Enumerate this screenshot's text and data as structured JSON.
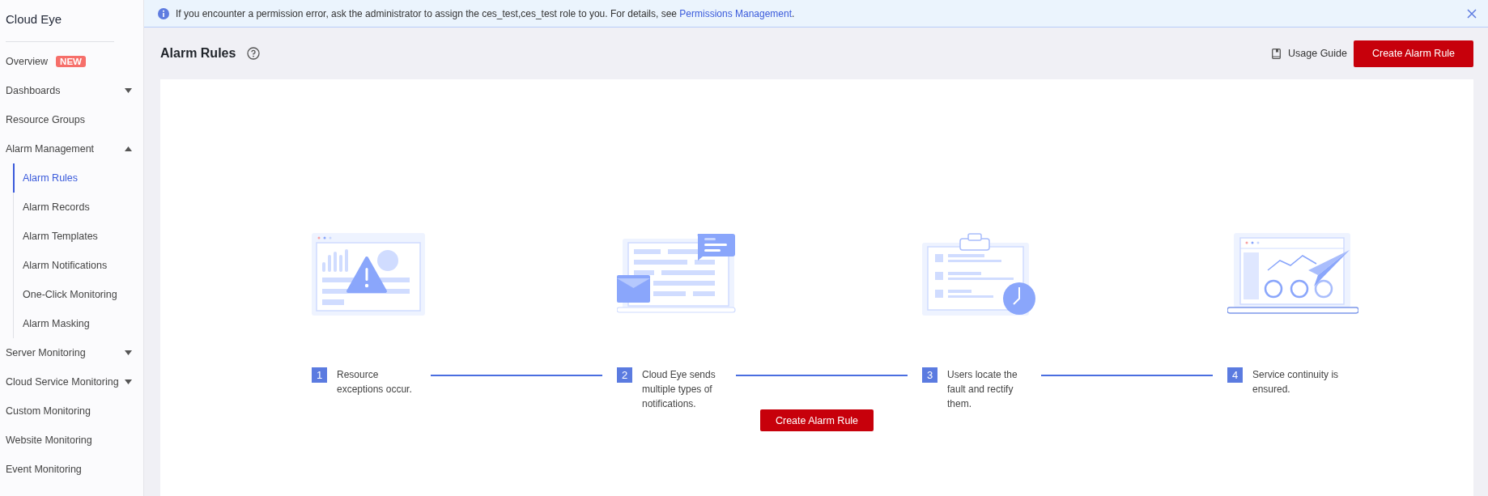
{
  "sidebar": {
    "title": "Cloud Eye",
    "items": [
      {
        "label": "Overview",
        "badge": "NEW",
        "kind": "link",
        "selected": false
      },
      {
        "label": "Dashboards",
        "kind": "group",
        "expanded": false,
        "selected": false
      },
      {
        "label": "Resource Groups",
        "kind": "link",
        "selected": false
      },
      {
        "label": "Alarm Management",
        "kind": "group",
        "expanded": true,
        "selected": false,
        "children": [
          {
            "label": "Alarm Rules",
            "selected": true
          },
          {
            "label": "Alarm Records",
            "selected": false
          },
          {
            "label": "Alarm Templates",
            "selected": false
          },
          {
            "label": "Alarm Notifications",
            "selected": false
          },
          {
            "label": "One-Click Monitoring",
            "selected": false
          },
          {
            "label": "Alarm Masking",
            "selected": false
          }
        ]
      },
      {
        "label": "Server Monitoring",
        "kind": "group",
        "expanded": false,
        "selected": false
      },
      {
        "label": "Cloud Service Monitoring",
        "kind": "group",
        "expanded": false,
        "selected": false
      },
      {
        "label": "Custom Monitoring",
        "kind": "link",
        "selected": false
      },
      {
        "label": "Website Monitoring",
        "kind": "link",
        "selected": false
      },
      {
        "label": "Event Monitoring",
        "kind": "link",
        "selected": false
      }
    ]
  },
  "banner": {
    "text": "If you encounter a permission error, ask the administrator to assign the ces_test,ces_test role to you. For details, see ",
    "link": "Permissions Management",
    "text_after": "."
  },
  "page": {
    "title": "Alarm Rules",
    "usage_guide": "Usage Guide",
    "create_button": "Create Alarm Rule"
  },
  "steps": [
    {
      "number": "1",
      "text": "Resource exceptions occur.",
      "kind": "dashboard-alert"
    },
    {
      "number": "2",
      "text": "Cloud Eye sends multiple types of notifications.",
      "kind": "laptop-mail"
    },
    {
      "number": "3",
      "text": "Users locate the fault and rectify them.",
      "kind": "clipboard-clock"
    },
    {
      "number": "4",
      "text": "Service continuity is ensured.",
      "kind": "laptop-plane"
    }
  ],
  "center_button": "Create Alarm Rule"
}
